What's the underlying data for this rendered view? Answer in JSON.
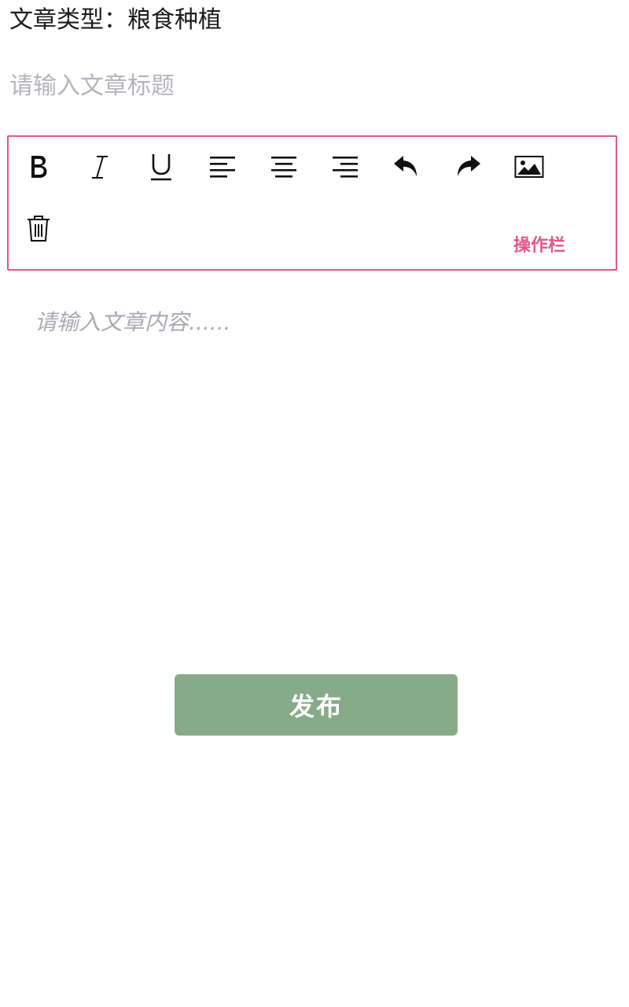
{
  "article_type": {
    "label": "文章类型：",
    "value": "粮食种植"
  },
  "title_input": {
    "placeholder": "请输入文章标题",
    "value": ""
  },
  "toolbar": {
    "label": "操作栏",
    "accent_color": "#e0578c",
    "buttons": [
      {
        "icon": "bold-icon"
      },
      {
        "icon": "italic-icon"
      },
      {
        "icon": "underline-icon"
      },
      {
        "icon": "align-left-icon"
      },
      {
        "icon": "align-center-icon"
      },
      {
        "icon": "align-right-icon"
      },
      {
        "icon": "undo-icon"
      },
      {
        "icon": "redo-icon"
      },
      {
        "icon": "image-icon"
      },
      {
        "icon": "trash-icon"
      }
    ]
  },
  "content_input": {
    "placeholder": "请输入文章内容......",
    "value": ""
  },
  "publish_button": {
    "label": "发布",
    "color": "#87ab88"
  }
}
